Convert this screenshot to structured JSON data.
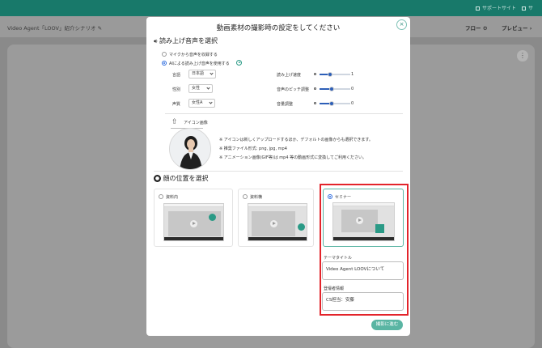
{
  "topbar": {
    "support_label": "サポートサイト",
    "extra_label": "サ"
  },
  "header": {
    "title": "Video Agent「LOOV」紹介シナリオ",
    "flow_label": "フロー",
    "preview_label": "プレビュー"
  },
  "modal": {
    "title": "動画素材の撮影時の設定をしてください",
    "close_label": "×",
    "voice_section": {
      "heading": "読み上げ音声を選択",
      "option_mic": "マイクから音声を収録する",
      "option_ai": "AIによる読み上げ音声を使用する",
      "language_label": "言語",
      "language_value": "日本語",
      "gender_label": "性別",
      "gender_value": "女性",
      "voice_label": "声質",
      "voice_value": "女性A",
      "speed_label": "読み上げ速度",
      "speed_value": "1",
      "pitch_label": "音声のピッチ調整",
      "pitch_value": "0",
      "volume_label": "音量調整",
      "volume_value": "0"
    },
    "icon_section": {
      "heading": "アイコン画像",
      "note1": "※ アイコンは新しくアップロードするほか、デフォルトの画像からも選択できます。",
      "note2": "※ 推奨ファイル形式: png, jpg, mp4",
      "note3": "※ アニメーション画像(GIF等)は mp4 等の動画形式に変換してご利用ください。"
    },
    "face_section": {
      "heading": "顔の位置を選択",
      "options": [
        {
          "label": "資料内"
        },
        {
          "label": "資料横"
        },
        {
          "label": "セミナー"
        }
      ],
      "theme_title_label": "テーマタイトル",
      "theme_title_value": "Video Agent LOOVについて",
      "presenter_label": "登壇者情報",
      "presenter_value": "CS担当：安藤"
    },
    "next_button": "撮影に進む"
  },
  "colors": {
    "topbar": "#18796a",
    "accent": "#5ab5a3",
    "radio_selected": "#2d6cdf",
    "highlight": "#e3242b"
  }
}
